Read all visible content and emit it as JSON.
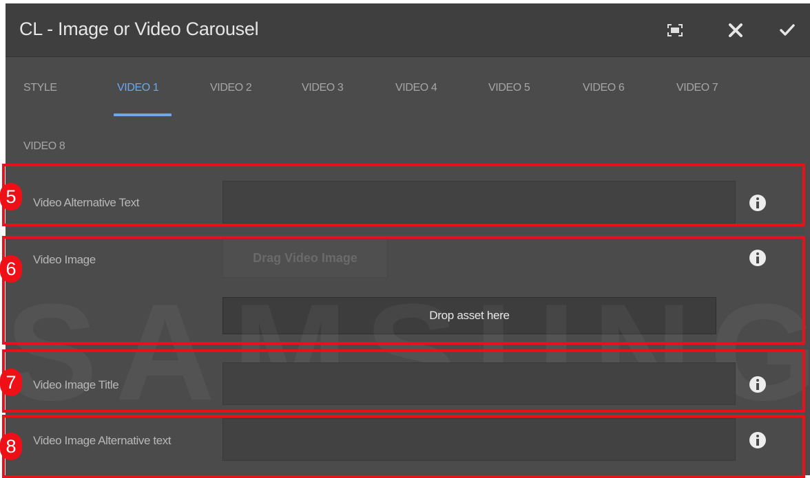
{
  "dialog": {
    "title": "CL - Image or Video Carousel",
    "actions": [
      {
        "name": "fullscreen-icon"
      },
      {
        "name": "close-icon"
      },
      {
        "name": "confirm-check-icon"
      }
    ]
  },
  "tabs": [
    "STYLE",
    "VIDEO 1",
    "VIDEO 2",
    "VIDEO 3",
    "VIDEO 4",
    "VIDEO 5",
    "VIDEO 6",
    "VIDEO 7",
    "VIDEO 8"
  ],
  "active_tab": "VIDEO 1",
  "fields": {
    "video_alt_text": {
      "label": "Video Alternative Text",
      "value": "",
      "badge": "5"
    },
    "video_image": {
      "label": "Video Image",
      "drag_button": "Drag Video Image",
      "drop_zone": "Drop asset here",
      "badge": "6"
    },
    "video_image_title": {
      "label": "Video Image Title",
      "value": "",
      "badge": "7"
    },
    "video_image_alt_text": {
      "label": "Video Image Alternative text",
      "value": "",
      "badge": "8"
    }
  },
  "watermark": "SAMSUNG",
  "colors": {
    "accent": "#6fa8ea",
    "callout_red": "#e8101a",
    "dialog_bg": "#4b4b4b"
  }
}
